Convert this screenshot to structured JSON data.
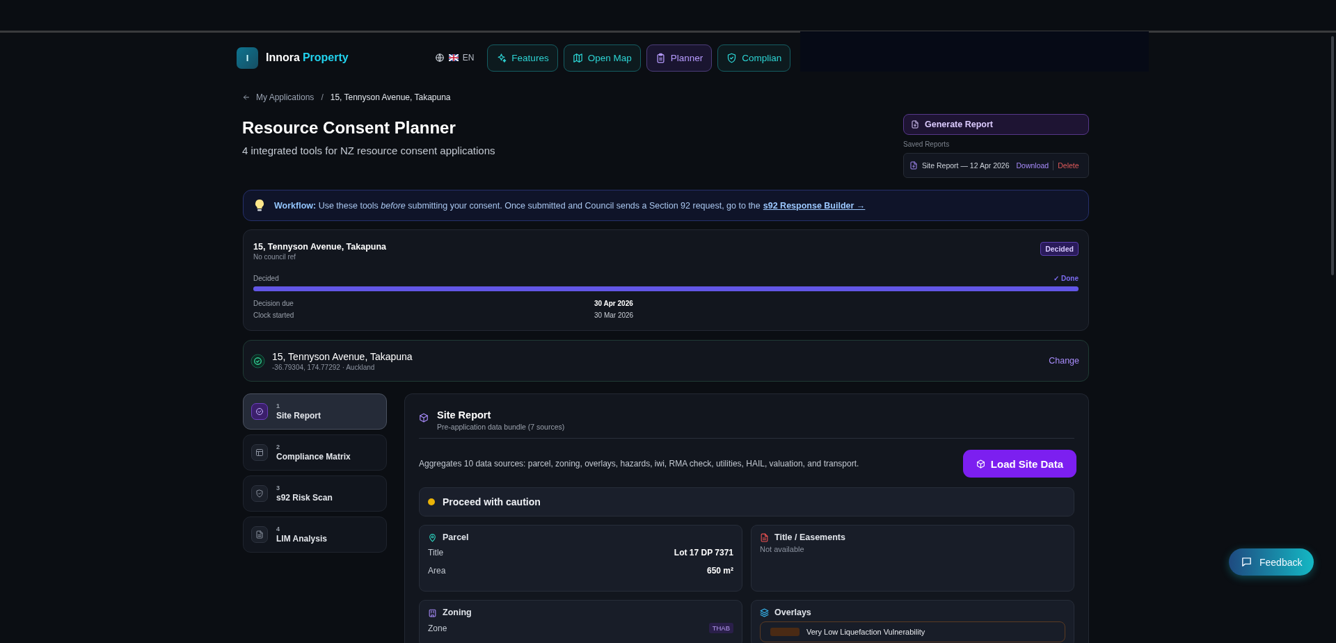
{
  "header": {
    "logo_letter": "I",
    "brand": "Innora",
    "brand_accent": "Property",
    "language": "EN",
    "nav": [
      {
        "label": "Features",
        "kind": "sparkle",
        "selected": false
      },
      {
        "label": "Open Map",
        "kind": "map",
        "selected": false
      },
      {
        "label": "Planner",
        "kind": "clipboard",
        "selected": true
      },
      {
        "label": "Complian",
        "kind": "shield",
        "selected": false
      }
    ]
  },
  "breadcrumb": {
    "back": "My Applications",
    "separator": "/",
    "current": "15, Tennyson Avenue, Takapuna"
  },
  "page": {
    "title": "Resource Consent Planner",
    "subtitle": "4 integrated tools for NZ resource consent applications"
  },
  "reports": {
    "generate": "Generate Report",
    "saved_label": "Saved Reports",
    "saved": [
      {
        "name": "Site Report — 12 Apr 2026",
        "download": "Download",
        "delete": "Delete"
      }
    ]
  },
  "workflow": {
    "text": "**Workflow:** Use these tools *before* submitting your consent. Once submitted and Council sends a Section 92 request, go to the",
    "link": "s92 Response Builder →"
  },
  "application": {
    "address": "15, Tennyson Avenue, Takapuna",
    "ref": "No council ref",
    "status": "Decided",
    "stage": "Decided",
    "stage_state": "✓ Done",
    "level": 1,
    "dates": [
      {
        "label": "Decision due",
        "value": "30 Apr 2026",
        "emphasis": true
      },
      {
        "label": "Clock started",
        "value": "30 Mar 2026",
        "emphasis": false
      }
    ]
  },
  "location": {
    "address": "15, Tennyson Avenue, Takapuna",
    "coords": "-36.79304, 174.77292 · Auckland",
    "action": "Change"
  },
  "steps": [
    {
      "number": "1",
      "label": "Site Report",
      "kind": "check",
      "selected": true
    },
    {
      "number": "2",
      "label": "Compliance Matrix",
      "kind": "table",
      "selected": false
    },
    {
      "number": "3",
      "label": "s92 Risk Scan",
      "kind": "shield",
      "selected": false
    },
    {
      "number": "4",
      "label": "LIM Analysis",
      "kind": "document",
      "selected": false
    }
  ],
  "panel": {
    "title": "Site Report",
    "subtitle": "Pre-application data bundle (7 sources)",
    "description": "Aggregates 10 data sources: parcel, zoning, overlays, hazards, iwi, RMA check, utilities, HAIL, valuation, and transport.",
    "action": "Load Site Data",
    "verdict": {
      "text": "Proceed with caution",
      "color": "#eab308"
    },
    "cards": [
      {
        "kind": "parcel",
        "title": "Parcel",
        "rows": [
          {
            "label": "Title",
            "value": "Lot 17 DP 7371"
          },
          {
            "label": "Area",
            "value": "650 m²"
          }
        ]
      },
      {
        "kind": "title",
        "title": "Title / Easements",
        "note": "Not available"
      },
      {
        "kind": "zoning",
        "title": "Zoning",
        "rows": [
          {
            "label": "Zone",
            "badge": "THAB"
          }
        ]
      },
      {
        "kind": "overlays",
        "title": "Overlays",
        "items": [
          {
            "text": "Very Low Liquefaction Vulnerability"
          }
        ]
      }
    ]
  },
  "feedback": "Feedback"
}
